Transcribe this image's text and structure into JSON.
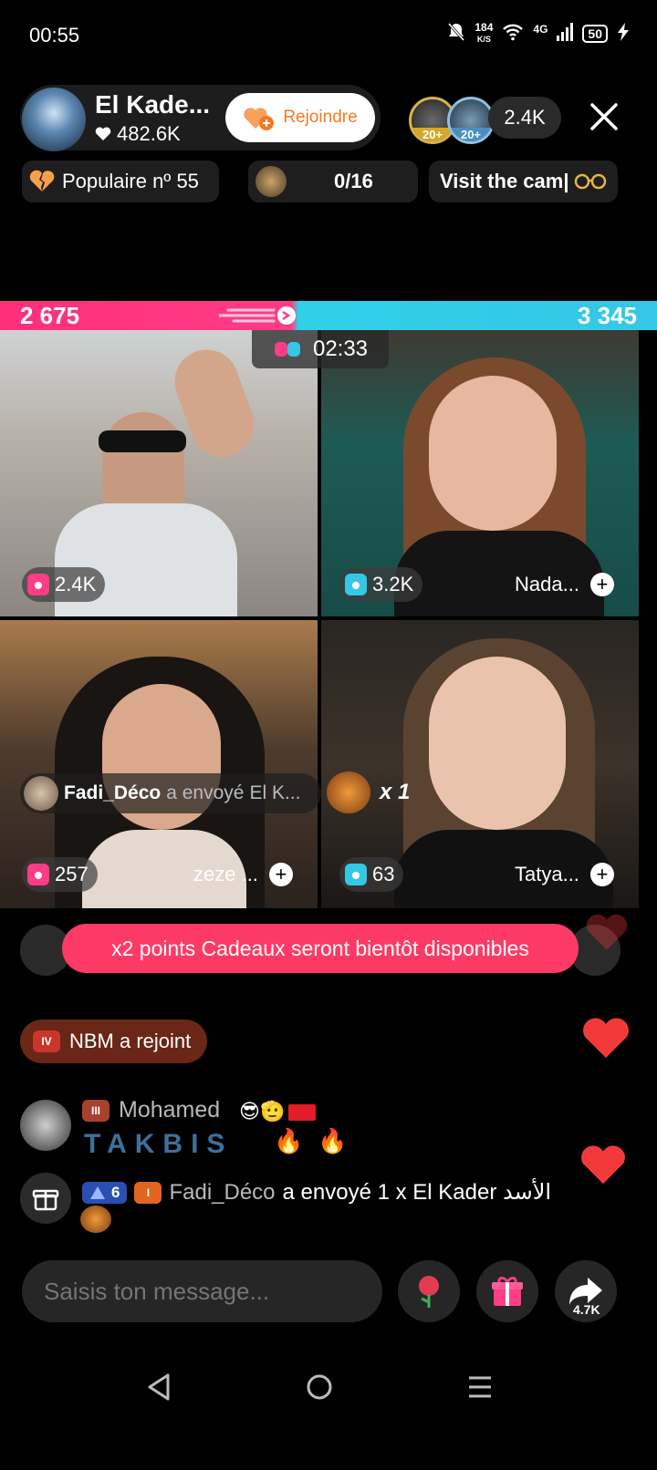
{
  "status": {
    "time": "00:55",
    "speed_value": "184",
    "speed_unit": "K/S",
    "network": "4G",
    "battery": "50"
  },
  "host": {
    "name": "El Kade...",
    "likes": "482.6K",
    "join_label": "Rejoindre"
  },
  "viewers": {
    "badge1": "20+",
    "badge2": "20+",
    "count": "2.4K"
  },
  "pills": {
    "popular": "Populaire nº 55",
    "progress": "0/16",
    "campaign": "Visit the cam|"
  },
  "battle": {
    "score_left": "2 675",
    "score_right": "3 345",
    "timer": "02:33",
    "left_ratio": 0.444
  },
  "guests": [
    {
      "score": "2.4K",
      "name": ""
    },
    {
      "score": "3.2K",
      "name": "Nada..."
    },
    {
      "score": "257",
      "name": "zeze ..."
    },
    {
      "score": "63",
      "name": "Tatya..."
    }
  ],
  "gift_notice": {
    "sender": "Fadi_Déco",
    "action": "a envoyé",
    "recipient": "El K...",
    "count": "x 1"
  },
  "banner": "x2 points Cadeaux seront bientôt disponibles",
  "join_event": {
    "badge": "IV",
    "text": "NBM a rejoint"
  },
  "comment": {
    "badge": "III",
    "name": "Mohamed",
    "text": "TAKBIS"
  },
  "gift_event": {
    "tier": "6",
    "badge": "I",
    "sender": "Fadi_Déco",
    "text": "a envoyé 1 x El Kader الأسد"
  },
  "input": {
    "placeholder": "Saisis ton message..."
  },
  "share_count": "4.7K",
  "colors": {
    "pink": "#fd3a66",
    "cyan": "#35c7e6",
    "orange": "#f47a22"
  }
}
